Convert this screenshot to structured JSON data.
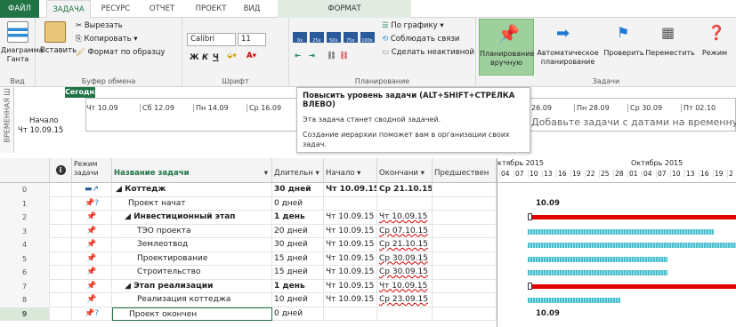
{
  "tabs": {
    "file": "ФАЙЛ",
    "task": "ЗАДАЧА",
    "resource": "РЕСУРС",
    "report": "ОТЧЕТ",
    "project": "ПРОЕКТ",
    "view": "ВИД",
    "format": "ФОРМАТ"
  },
  "ribbon": {
    "view_group": {
      "gantt_label": "Диаграмма Ганта",
      "label": "Вид"
    },
    "clipboard": {
      "paste": "Вставить",
      "cut": "Вырезать",
      "copy": "Копировать",
      "format_painter": "Формат по образцу",
      "label": "Буфер обмена"
    },
    "font": {
      "family": "Calibri",
      "size": "11",
      "bold": "Ж",
      "italic": "К",
      "underline": "Ч",
      "label": "Шрифт"
    },
    "schedule": {
      "on_track": "По графику",
      "respect_links": "Соблюдать связи",
      "inactivate": "Сделать неактивной",
      "label": "Планирование",
      "pcts": [
        "0x",
        "25x",
        "50x",
        "75x",
        "100x"
      ]
    },
    "tasks": {
      "manual": "Планирование вручную",
      "auto": "Автоматическое планирование",
      "inspect": "Проверить",
      "move": "Переместить",
      "mode": "Режим",
      "label": "Задачи"
    }
  },
  "timeline": {
    "side_label": "ВРЕМЕННАЯ Ш",
    "today": "Сегодня",
    "start_label": "Начало",
    "start_date": "Чт 10.09.15",
    "ticks": [
      "Чт 10.09",
      "Сб 12.09",
      "Пн 14.09",
      "Ср 16.09",
      "26.09",
      "Пн 28.09",
      "Ср 30.09",
      "Пт 02.10"
    ],
    "placeholder": "Добавьте задачи с датами на временную"
  },
  "tooltip": {
    "title": "Повысить уровень задачи (ALT+SHIFT+СТРЕЛКА ВЛЕВО)",
    "line1": "Эта задача станет сводной задачей.",
    "line2": "Создание иерархии поможет вам в организации своих задач."
  },
  "grid": {
    "headers": {
      "mode": "Режим задачи",
      "name": "Название задачи",
      "duration": "Длительн",
      "start": "Начало",
      "finish": "Окончани",
      "pred": "Предшествен"
    },
    "rows": [
      {
        "n": "0",
        "name": "Коттедж",
        "dur": "30 дней",
        "start": "Чт 10.09.15",
        "fin": "Ср 21.10.15"
      },
      {
        "n": "1",
        "name": "Проект начат",
        "dur": "0 дней",
        "start": "",
        "fin": ""
      },
      {
        "n": "2",
        "name": "Инвестиционный этап",
        "dur": "1 день",
        "start": "Чт 10.09.15",
        "fin": "Чт 10.09.15"
      },
      {
        "n": "3",
        "name": "ТЭО проекта",
        "dur": "20 дней",
        "start": "Чт 10.09.15",
        "fin": "Ср 07.10.15"
      },
      {
        "n": "4",
        "name": "Землеотвод",
        "dur": "30 дней",
        "start": "Чт 10.09.15",
        "fin": "Ср 21.10.15"
      },
      {
        "n": "5",
        "name": "Проектирование",
        "dur": "15 дней",
        "start": "Чт 10.09.15",
        "fin": "Ср 30.09.15"
      },
      {
        "n": "6",
        "name": "Строительство",
        "dur": "15 дней",
        "start": "Чт 10.09.15",
        "fin": "Ср 30.09.15"
      },
      {
        "n": "7",
        "name": "Этап реализации",
        "dur": "1 день",
        "start": "Чт 10.09.15",
        "fin": "Чт 10.09.15"
      },
      {
        "n": "8",
        "name": "Реализация коттеджа",
        "dur": "10 дней",
        "start": "Чт 10.09.15",
        "fin": "Ср 23.09.15"
      },
      {
        "n": "9",
        "name": "Проект окончен",
        "dur": "0 дней",
        "start": "",
        "fin": ""
      }
    ]
  },
  "gantt": {
    "month1": "ктябрь 2015",
    "month2": "Октябрь 2015",
    "days": [
      "04",
      "07",
      "10",
      "13",
      "16",
      "19",
      "22",
      "25",
      "28",
      "01",
      "04",
      "07",
      "10",
      "13",
      "16",
      "19",
      "2"
    ],
    "milestone1": "10.09",
    "milestone2": "10.09"
  }
}
